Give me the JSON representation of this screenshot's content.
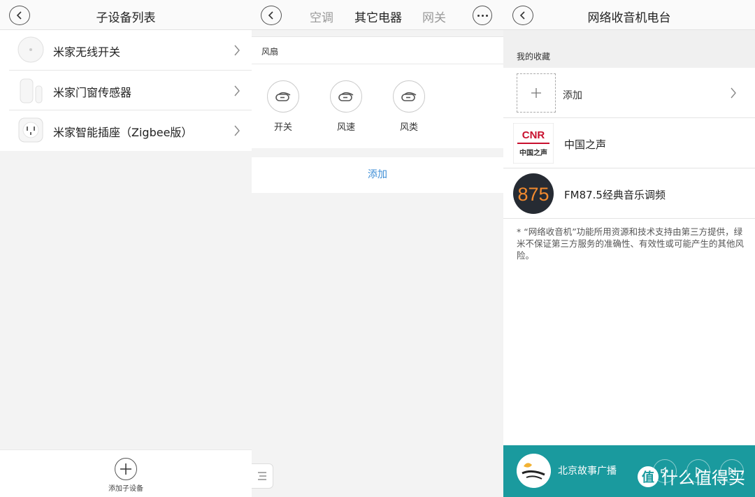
{
  "panel1": {
    "title": "子设备列表",
    "devices": [
      {
        "name": "米家无线开关",
        "icon": "wireless-switch-icon"
      },
      {
        "name": "米家门窗传感器",
        "icon": "door-sensor-icon"
      },
      {
        "name": "米家智能插座（Zigbee版）",
        "icon": "smart-plug-icon"
      }
    ],
    "add_label": "添加子设备"
  },
  "panel2": {
    "tabs": [
      "空调",
      "其它电器",
      "网关"
    ],
    "active_tab": "其它电器",
    "section_title": "风扇",
    "controls": [
      "开关",
      "风速",
      "风类"
    ],
    "add_label": "添加"
  },
  "panel3": {
    "title": "网络收音机电台",
    "favorites_header": "我的收藏",
    "add_label": "添加",
    "stations": [
      {
        "name": "中国之声",
        "logo_text": "CNR",
        "logo_sub": "中国之声"
      },
      {
        "name": "FM87.5经典音乐调频",
        "logo_text": "875"
      }
    ],
    "disclaimer": "* “网络收音机”功能所用资源和技术支持由第三方提供，绿米不保证第三方服务的准确性、有效性或可能产生的其他风险。",
    "player": {
      "station": "北京故事广播"
    },
    "watermark": "什么值得买",
    "watermark_badge": "值"
  },
  "colors": {
    "accent": "#3c8dd6",
    "player_bg": "#1a9a9e"
  }
}
